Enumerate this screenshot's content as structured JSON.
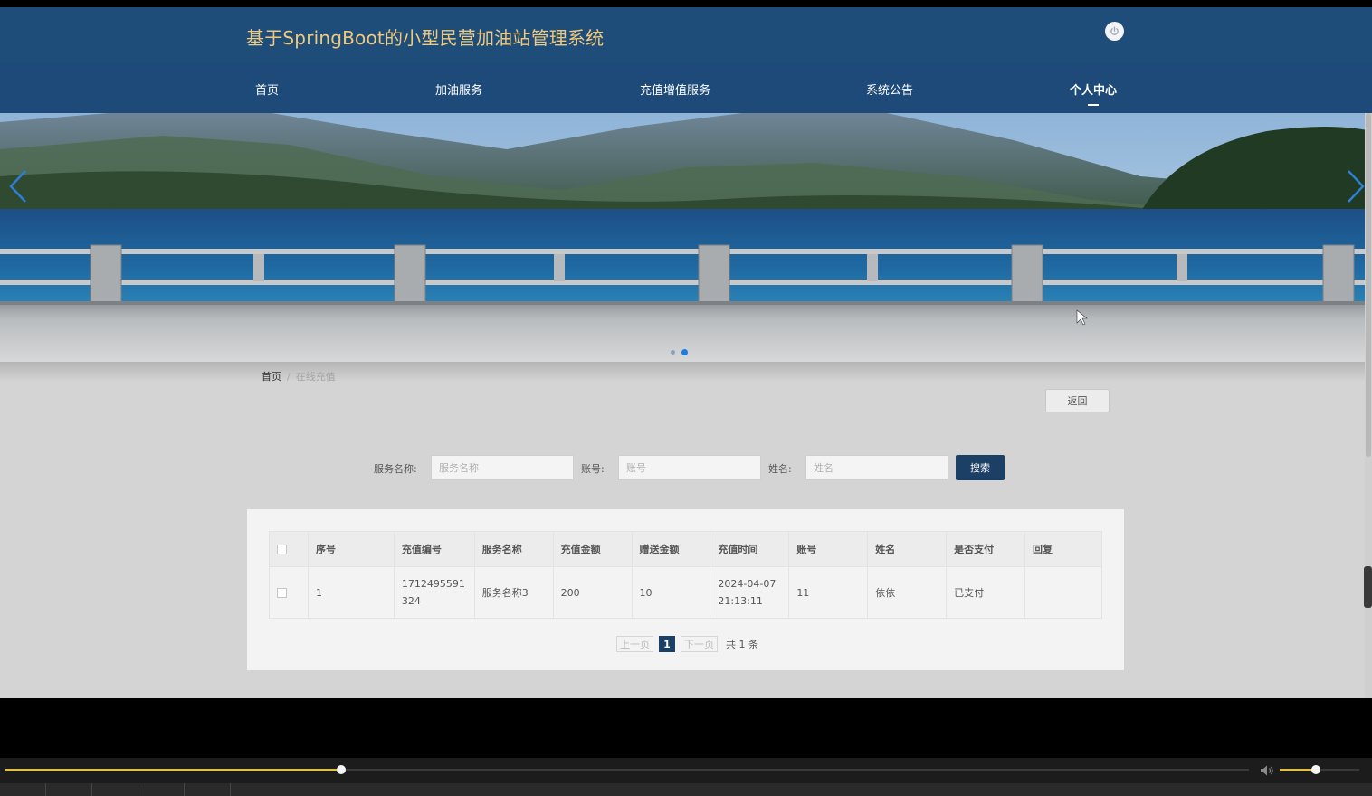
{
  "header": {
    "site_title": "基于SpringBoot的小型民营加油站管理系统",
    "power_icon": "power-icon"
  },
  "nav": {
    "items": [
      {
        "label": "首页"
      },
      {
        "label": "加油服务"
      },
      {
        "label": "充值增值服务"
      },
      {
        "label": "系统公告"
      },
      {
        "label": "个人中心",
        "active": true
      }
    ]
  },
  "banner": {
    "slide_count": 2,
    "active_slide": 2,
    "prev_icon": "chevron-left-icon",
    "next_icon": "chevron-right-icon"
  },
  "breadcrumb": {
    "home": "首页",
    "separator": "/",
    "current": "在线充值"
  },
  "actions": {
    "back_label": "返回",
    "search_label": "搜索"
  },
  "search": {
    "service_name_label": "服务名称:",
    "service_name_placeholder": "服务名称",
    "account_label": "账号:",
    "account_placeholder": "账号",
    "name_label": "姓名:",
    "name_placeholder": "姓名"
  },
  "table": {
    "headers": [
      "序号",
      "充值编号",
      "服务名称",
      "充值金额",
      "赠送金额",
      "充值时间",
      "账号",
      "姓名",
      "是否支付",
      "回复"
    ],
    "rows": [
      [
        "1",
        "1712495591324",
        "服务名称3",
        "200",
        "10",
        "2024-04-07 21:13:11",
        "11",
        "依依",
        "已支付",
        ""
      ]
    ]
  },
  "pagination": {
    "prev_label": "上一页",
    "current_page": "1",
    "next_label": "下一页",
    "total_label": "共 1 条"
  },
  "player": {
    "progress": 0.27,
    "volume": 0.45,
    "volume_icon": "volume-icon"
  },
  "colors": {
    "header_bg": "#1f4d7a",
    "title_gold": "#f1c97a",
    "primary_btn": "#1c3f66",
    "progress_yellow": "#e2c23c"
  }
}
